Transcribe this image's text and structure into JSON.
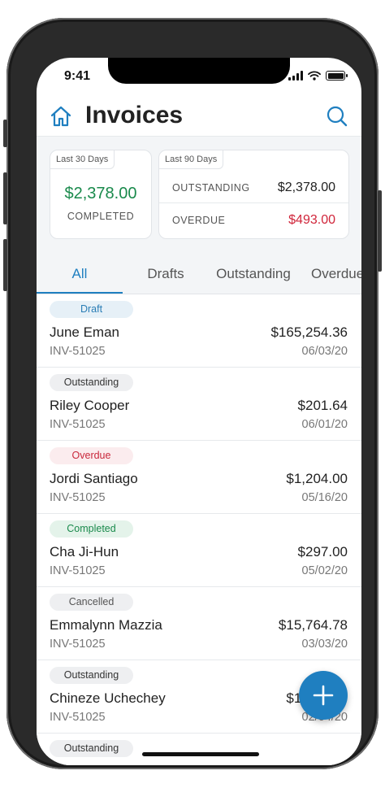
{
  "status": {
    "time": "9:41"
  },
  "header": {
    "title": "Invoices",
    "home_icon": "home-icon",
    "search_icon": "search-icon"
  },
  "summary": {
    "card30": {
      "tag": "Last 30 Days",
      "amount": "$2,378.00",
      "label": "COMPLETED"
    },
    "card90": {
      "tag": "Last 90 Days",
      "outstanding_label": "OUTSTANDING",
      "outstanding_value": "$2,378.00",
      "overdue_label": "OVERDUE",
      "overdue_value": "$493.00"
    }
  },
  "tabs": [
    {
      "label": "All",
      "active": true
    },
    {
      "label": "Drafts"
    },
    {
      "label": "Outstanding"
    },
    {
      "label": "Overdue"
    }
  ],
  "invoices": [
    {
      "status": "Draft",
      "kind": "draft",
      "name": "June Eman",
      "amount": "$165,254.36",
      "number": "INV-51025",
      "date": "06/03/20"
    },
    {
      "status": "Outstanding",
      "kind": "outstanding",
      "name": "Riley Cooper",
      "amount": "$201.64",
      "number": "INV-51025",
      "date": "06/01/20"
    },
    {
      "status": "Overdue",
      "kind": "overdue",
      "name": "Jordi Santiago",
      "amount": "$1,204.00",
      "number": "INV-51025",
      "date": "05/16/20"
    },
    {
      "status": "Completed",
      "kind": "completed",
      "name": "Cha Ji-Hun",
      "amount": "$297.00",
      "number": "INV-51025",
      "date": "05/02/20"
    },
    {
      "status": "Cancelled",
      "kind": "cancelled",
      "name": "Emmalynn Mazzia",
      "amount": "$15,764.78",
      "number": "INV-51025",
      "date": "03/03/20"
    },
    {
      "status": "Outstanding",
      "kind": "outstanding",
      "name": "Chineze Uchechey",
      "amount": "$1,204.00",
      "number": "INV-51025",
      "date": "02/04/20"
    },
    {
      "status": "Outstanding",
      "kind": "outstanding",
      "name": "",
      "amount": "",
      "number": "",
      "date": ""
    }
  ],
  "colors": {
    "accent": "#1f7fc0",
    "positive": "#1a8a4c",
    "negative": "#d0253a"
  },
  "fab": {
    "icon": "plus-icon"
  }
}
